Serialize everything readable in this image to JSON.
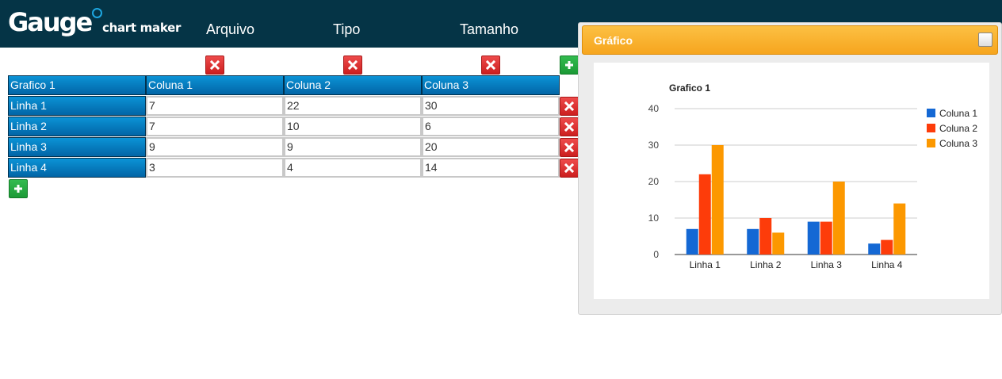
{
  "header": {
    "logo_text": "Gauge",
    "logo_sub": "chart maker",
    "menu": [
      "Arquivo",
      "Tipo",
      "Tamanho"
    ]
  },
  "table": {
    "corner": "Grafico 1",
    "columns": [
      "Coluna 1",
      "Coluna 2",
      "Coluna 3"
    ],
    "rows": [
      {
        "label": "Linha 1",
        "values": [
          "7",
          "22",
          "30"
        ]
      },
      {
        "label": "Linha 2",
        "values": [
          "7",
          "10",
          "6"
        ]
      },
      {
        "label": "Linha 3",
        "values": [
          "9",
          "9",
          "20"
        ]
      },
      {
        "label": "Linha 4",
        "values": [
          "3",
          "4",
          "14"
        ]
      }
    ]
  },
  "panel": {
    "title": "Gráfico"
  },
  "chart_data": {
    "type": "bar",
    "title": "Grafico 1",
    "categories": [
      "Linha 1",
      "Linha 2",
      "Linha 3",
      "Linha 4"
    ],
    "series": [
      {
        "name": "Coluna 1",
        "color": "#1468d4",
        "values": [
          7,
          7,
          9,
          3
        ]
      },
      {
        "name": "Coluna 2",
        "color": "#fd3c0a",
        "values": [
          22,
          10,
          9,
          4
        ]
      },
      {
        "name": "Coluna 3",
        "color": "#fc9800",
        "values": [
          30,
          6,
          20,
          14
        ]
      }
    ],
    "ylim": [
      0,
      40
    ],
    "yticks": [
      0,
      10,
      20,
      30,
      40
    ],
    "grid": true,
    "legend": "right"
  },
  "colors": {
    "topbar": "#053446",
    "header_cell": "#0578c0",
    "delete": "#dd3333",
    "add": "#22a83f",
    "panel_header": "#f9b02e"
  },
  "icons": {
    "delete": "x-icon",
    "add": "plus-icon",
    "toggle": "checkbox-icon"
  }
}
